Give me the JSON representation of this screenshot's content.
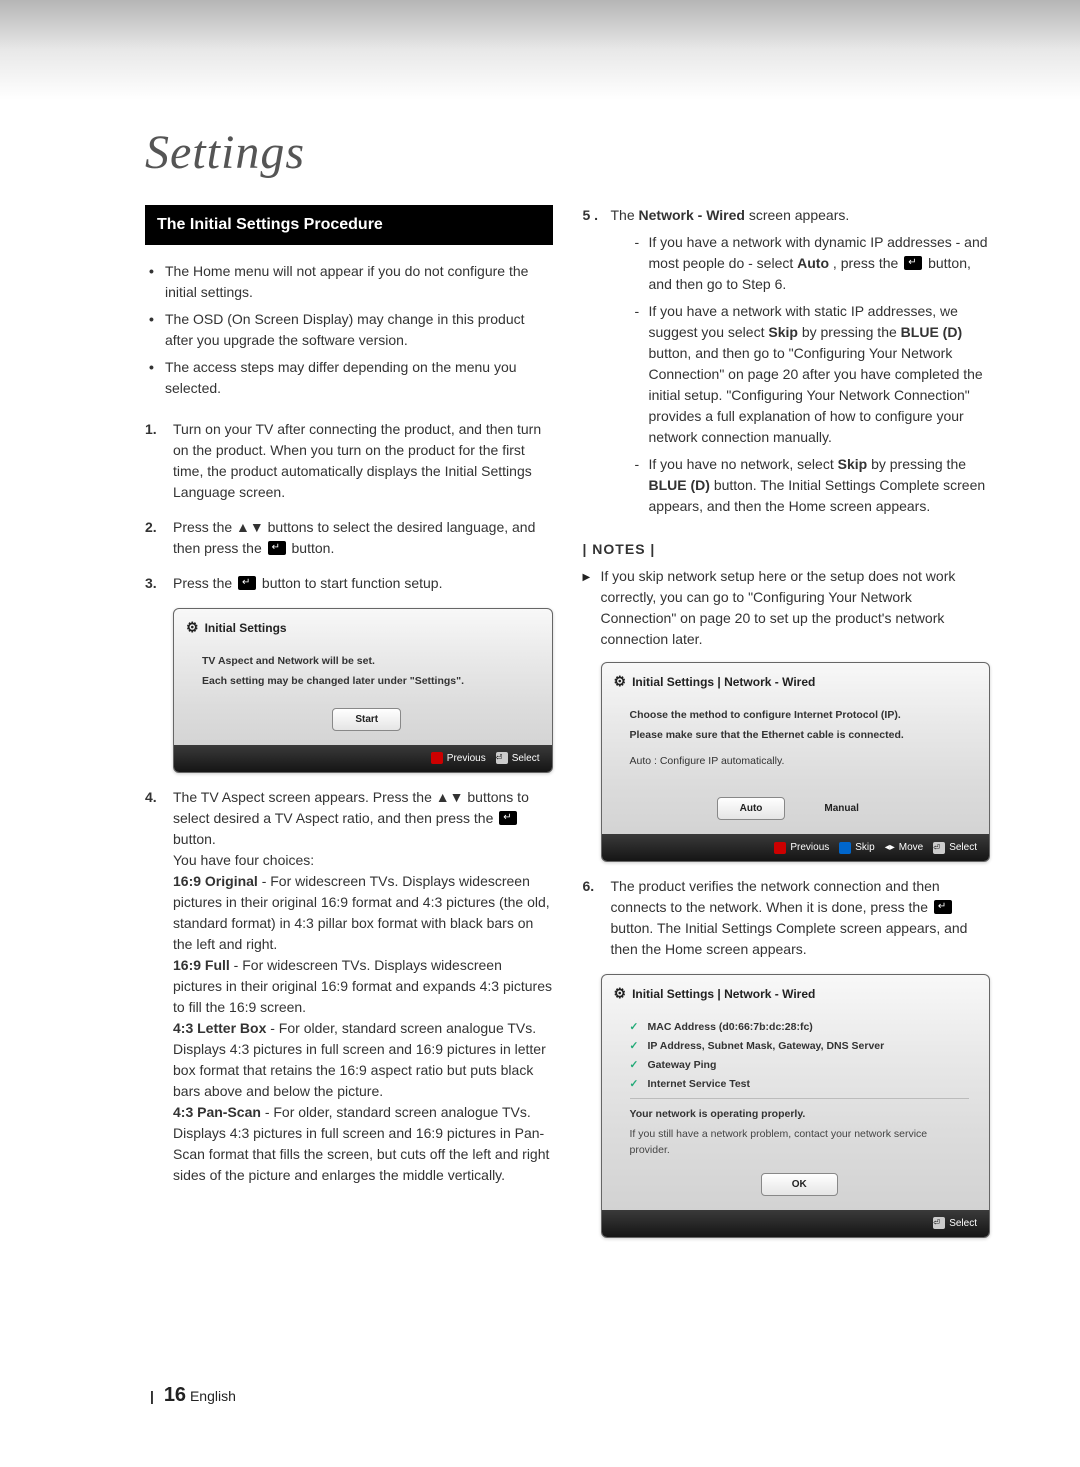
{
  "chapter_title": "Settings",
  "section_title": "The Initial Settings Procedure",
  "left_notes": [
    "The Home menu will not appear if you do not configure the initial settings.",
    "The OSD (On Screen Display) may change in this product after you upgrade the software version.",
    "The access steps may differ depending on the menu you selected."
  ],
  "steps": {
    "s1": {
      "num": "1.",
      "text": "Turn on your TV after connecting the product, and then turn on the product. When you turn on the product for the first time, the product automatically displays the Initial Settings Language screen."
    },
    "s2": {
      "num": "2.",
      "pre": "Press the ▲▼ buttons to select the desired language, and then press the ",
      "post": " button."
    },
    "s3": {
      "num": "3.",
      "pre": "Press the ",
      "post": " button to start function setup."
    },
    "s4": {
      "num": "4.",
      "pre": "The TV Aspect screen appears. Press the ▲▼ buttons to select desired a TV Aspect ratio, and then press the ",
      "post": " button.",
      "choices_intro": "You have four choices:",
      "a1_b": "16:9 Original",
      "a1_t": " - For widescreen TVs. Displays widescreen pictures in their original 16:9 format and 4:3 pictures (the old, standard format) in 4:3 pillar box format with black bars on the left and right.",
      "a2_b": "16:9 Full",
      "a2_t": " - For widescreen TVs. Displays widescreen pictures in their original 16:9 format and expands 4:3 pictures to fill the 16:9 screen.",
      "a3_b": "4:3 Letter Box",
      "a3_t": " - For older, standard screen analogue TVs. Displays 4:3 pictures in full screen and 16:9 pictures in letter box format that retains the 16:9 aspect ratio but puts black bars above and below the picture.",
      "a4_b": "4:3 Pan-Scan",
      "a4_t": " - For older, standard screen analogue TVs. Displays 4:3 pictures in full screen and 16:9 pictures in Pan-Scan format that fills the screen, but cuts off the left and right sides of the picture and enlarges the middle vertically."
    },
    "s5": {
      "num": "5 .",
      "intro_pre": "The ",
      "intro_bold": "Network - Wired",
      "intro_post": " screen appears.",
      "d1_a": "If you have a network with dynamic IP addresses - and most people do - select ",
      "d1_b": "Auto",
      "d1_c": ", press the ",
      "d1_d": " button, and then go to Step 6.",
      "d2_a": "If you have a network with static IP addresses, we suggest you select ",
      "d2_b": "Skip",
      "d2_c": " by pressing the ",
      "d2_d": "BLUE (D)",
      "d2_e": " button, and then go to \"Configuring Your Network Connection\" on page 20 after you have completed the initial setup. \"Configuring Your Network Connection\" provides a full explanation of how to configure your network connection manually.",
      "d3_a": "If you have no network, select ",
      "d3_b": "Skip",
      "d3_c": " by pressing the ",
      "d3_d": "BLUE (D)",
      "d3_e": " button. The Initial Settings Complete screen appears, and then the Home screen appears."
    },
    "s6": {
      "num": "6.",
      "a": "The product verifies the network connection and then connects to the network. When it is done, press the ",
      "b": " button. The Initial Settings Complete screen appears, and then the Home screen appears."
    }
  },
  "notes_header": "| NOTES |",
  "notes_item": "If you skip network setup here or the setup does not work correctly, you can go to \"Configuring Your Network Connection\" on page 20 to set up the product's network connection later.",
  "osd1": {
    "title": "Initial Settings",
    "line1": "TV Aspect and Network will be set.",
    "line2": "Each setting may be changed later under \"Settings\".",
    "start": "Start",
    "f_prev": "Previous",
    "f_sel": "Select"
  },
  "osd2": {
    "title": "Initial Settings | Network - Wired",
    "line1": "Choose the method to configure Internet Protocol (IP).",
    "line2": "Please make sure that the Ethernet cable is connected.",
    "line3": "Auto : Configure IP automatically.",
    "auto": "Auto",
    "manual": "Manual",
    "f_prev": "Previous",
    "f_skip": "Skip",
    "f_move": "Move",
    "f_sel": "Select"
  },
  "osd3": {
    "title": "Initial Settings | Network - Wired",
    "c1": "MAC Address (d0:66:7b:dc:28:fc)",
    "c2": "IP Address, Subnet Mask, Gateway, DNS Server",
    "c3": "Gateway Ping",
    "c4": "Internet Service Test",
    "msg1": "Your network is operating properly.",
    "msg2": "If you still have a network problem, contact your network service provider.",
    "ok": "OK",
    "f_sel": "Select"
  },
  "footer": {
    "page": "16",
    "lang": "English"
  }
}
